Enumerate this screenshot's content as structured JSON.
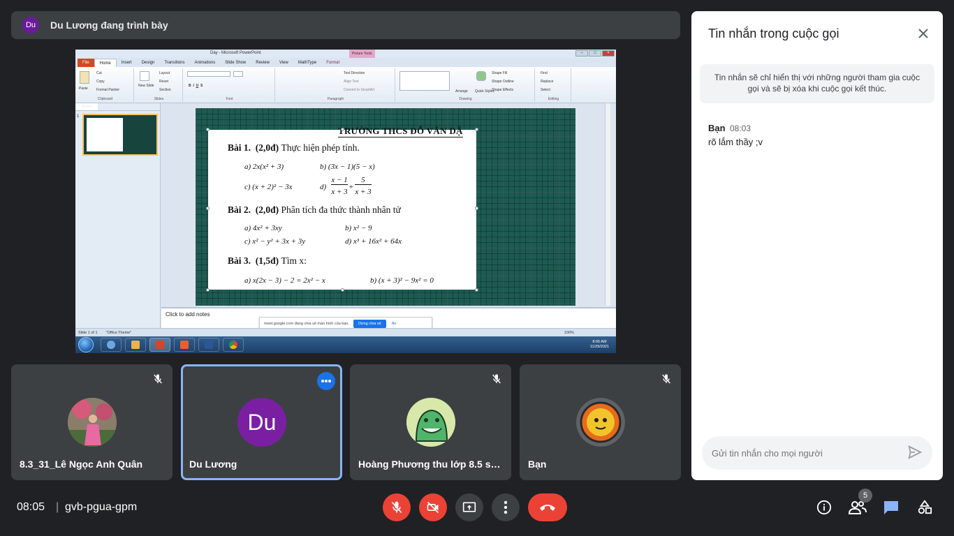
{
  "presenter": {
    "initials": "Du",
    "text": "Du Lương đang trình bày"
  },
  "screen": {
    "window_title": "Day - Microsoft PowerPoint",
    "picture_tools": "Picture Tools",
    "tabs": [
      "File",
      "Home",
      "Insert",
      "Design",
      "Transitions",
      "Animations",
      "Slide Show",
      "Review",
      "View",
      "MathType",
      "Format"
    ],
    "ribbon": {
      "clipboard": {
        "label": "Clipboard",
        "paste": "Paste",
        "cut": "Cut",
        "copy": "Copy",
        "format_painter": "Format Painter"
      },
      "slides": {
        "label": "Slides",
        "new_slide": "New Slide",
        "layout": "Layout",
        "reset": "Reset",
        "section": "Section"
      },
      "font": {
        "label": "Font"
      },
      "paragraph": {
        "label": "Paragraph",
        "text_direction": "Text Direction",
        "align_text": "Align Text",
        "smartart": "Convert to SmartArt"
      },
      "drawing": {
        "label": "Drawing",
        "arrange": "Arrange",
        "quick_styles": "Quick Styles",
        "shape_fill": "Shape Fill",
        "shape_outline": "Shape Outline",
        "shape_effects": "Shape Effects"
      },
      "editing": {
        "label": "Editing",
        "find": "Find",
        "replace": "Replace",
        "select": "Select"
      }
    },
    "pane_tabs": [
      "Slides",
      "Outline"
    ],
    "thumb_number": "1",
    "slide": {
      "school": "TRƯỜNG THCS ĐỖ VĂN DẬ",
      "bai1_title": "Bài 1.",
      "bai1_points": "(2,0đ)",
      "bai1_text": "Thực hiện phép tính.",
      "b1a": "a) 2x(x² + 3)",
      "b1b": "b) (3x − 1)(5 − x)",
      "b1c": "c) (x + 2)² − 3x",
      "b1d_prefix": "d)",
      "b1d_num1": "x − 1",
      "b1d_den1": "x + 3",
      "b1d_plus": "+",
      "b1d_num2": "5",
      "b1d_den2": "x + 3",
      "bai2_title": "Bài 2.",
      "bai2_points": "(2,0đ)",
      "bai2_text": "Phân tích đa thức thành nhân tử",
      "b2a": "a) 4x² + 3xy",
      "b2b": "b) x² − 9",
      "b2c": "c) x² − y² + 3x + 3y",
      "b2d": "d) x³ + 16x² + 64x",
      "bai3_title": "Bài 3.",
      "bai3_points": "(1,5đ)",
      "bai3_text": "Tìm x:",
      "b3a": "a) x(2x − 3) − 2 = 2x² − x",
      "b3b": "b) (x + 3)² − 9x² = 0"
    },
    "notes_placeholder": "Click to add notes",
    "share_notice": "meet.google.com đang chia sẻ màn hình của bạn.",
    "stop_share": "Dừng chia sẻ",
    "hide": "Ẩn",
    "status": {
      "slide": "Slide 1 of 1",
      "theme": "\"Office Theme\"",
      "zoom": "100%"
    },
    "taskbar_clock": {
      "time": "8:05 AM",
      "date": "11/29/2021"
    }
  },
  "participants": [
    {
      "name": "8.3_31_Lê Ngọc Anh Quân",
      "muted": true
    },
    {
      "name": "Du Lương",
      "initials": "Du",
      "active": true
    },
    {
      "name": "Hoàng Phương thu lớp 8.5 số ...",
      "muted": true
    },
    {
      "name": "Bạn",
      "muted": true
    }
  ],
  "bottom": {
    "time": "08:05",
    "separator": "|",
    "meeting_code": "gvb-pgua-gpm",
    "people_count": "5"
  },
  "chat": {
    "title": "Tin nhắn trong cuộc gọi",
    "notice": "Tin nhắn sẽ chỉ hiển thị với những người tham gia cuộc gọi và sẽ bị xóa khi cuộc gọi kết thúc.",
    "messages": [
      {
        "sender": "Bạn",
        "time": "08:03",
        "text": "rõ lắm thầy ;v"
      }
    ],
    "input_placeholder": "Gửi tin nhắn cho mọi người"
  },
  "colors": {
    "background": "#202124",
    "tile": "#3c4043",
    "red": "#ea4335",
    "blue": "#1a73e8",
    "active_border": "#8ab4f8"
  }
}
